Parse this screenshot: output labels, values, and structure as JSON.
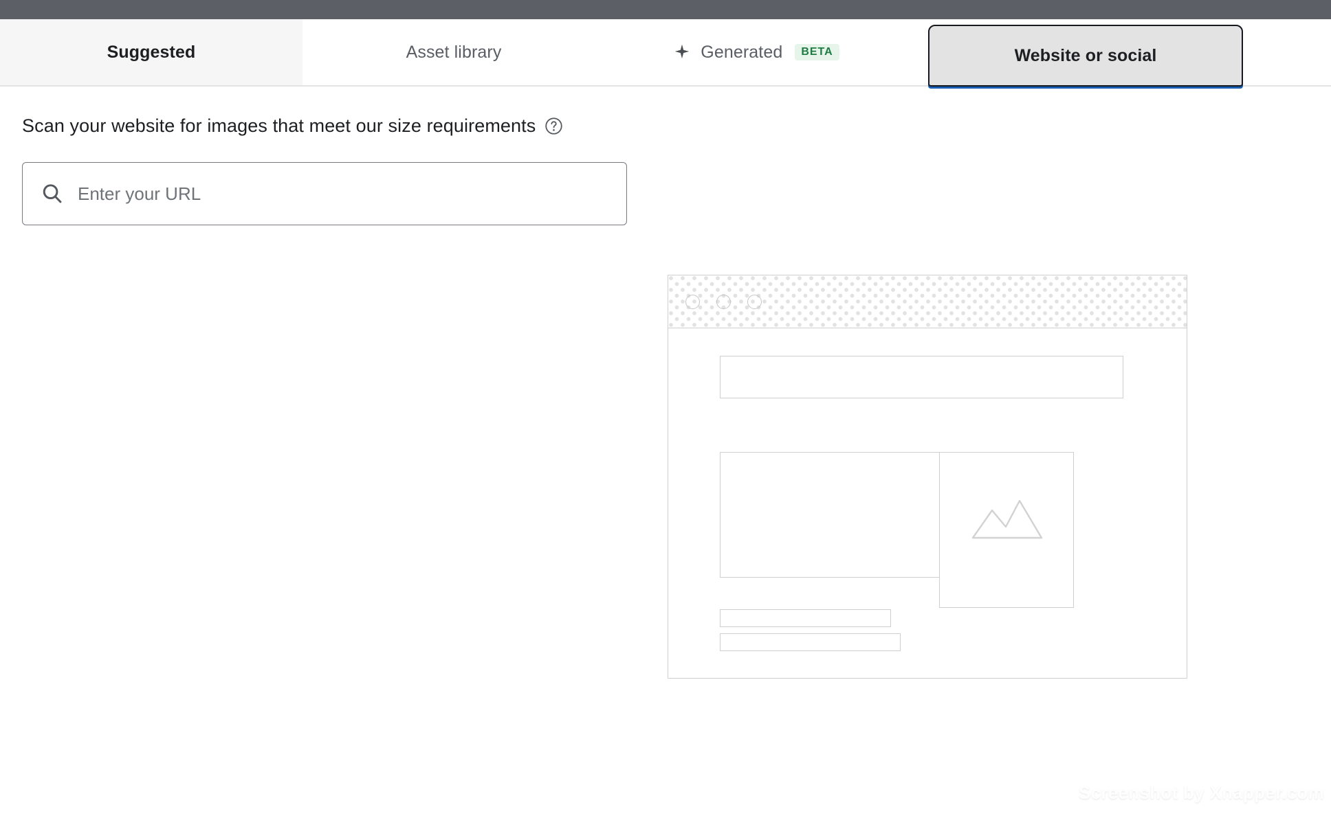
{
  "window": {
    "chrome_bar_color": "#5c5f66"
  },
  "tabs": {
    "active_index": 3,
    "items": [
      {
        "label": "Suggested",
        "name": "tab-suggested",
        "icon": null,
        "badge": null
      },
      {
        "label": "Asset library",
        "name": "tab-asset-library",
        "icon": null,
        "badge": null
      },
      {
        "label": "Generated",
        "name": "tab-generated",
        "icon": "sparkle-icon",
        "badge": "BETA"
      },
      {
        "label": "Website or social",
        "name": "tab-website-or-social",
        "icon": null,
        "badge": null
      }
    ],
    "active_underline_color": "#1a5fb4",
    "active_background_color": "#e3e3e3",
    "badge_background_color": "#e6f4ea",
    "badge_text_color": "#1e7b42"
  },
  "panel": {
    "heading": "Scan your website for images that meet our size requirements",
    "help_icon": "help-circle-icon"
  },
  "search": {
    "icon": "search-icon",
    "value": "",
    "placeholder": "Enter your URL"
  },
  "illustration": {
    "name": "website-wireframe-illustration",
    "titlebar_dots": 3,
    "outline_color": "#cfcfcf",
    "pattern_dot_color": "#e2e2e2",
    "media_icon": "mountain-image-icon",
    "boxes": [
      {
        "name": "wireframe-banner-box"
      },
      {
        "name": "wireframe-content-box"
      },
      {
        "name": "wireframe-media-box"
      },
      {
        "name": "wireframe-text-line-1"
      },
      {
        "name": "wireframe-text-line-2"
      }
    ]
  },
  "watermark": {
    "text": "Screenshot by Xnapper.com"
  }
}
